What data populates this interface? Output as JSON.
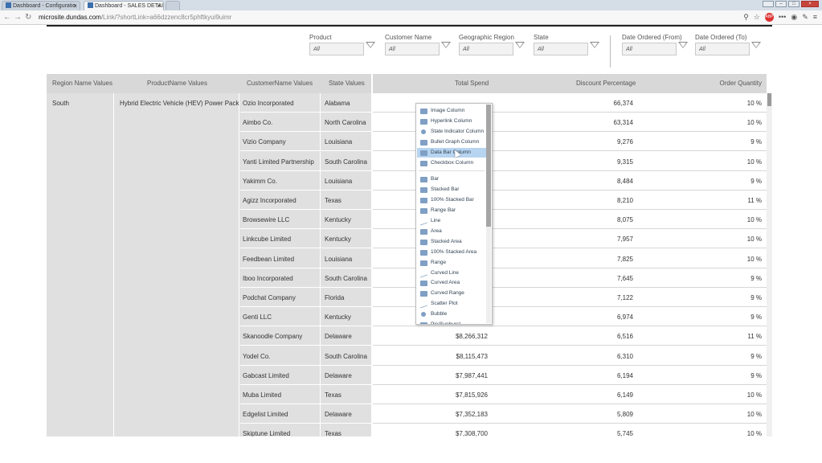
{
  "browser": {
    "tabs": [
      {
        "label": "Dashboard - Configuratio"
      },
      {
        "label": "Dashboard - SALES DETAI"
      }
    ],
    "url_domain": "microsite.dundas.com",
    "url_rest": "/Link/?shortLink=a66dzzenc8cr5phftkyui9uimr"
  },
  "filters": [
    {
      "label": "Product",
      "value": "All"
    },
    {
      "label": "Customer Name",
      "value": "All"
    },
    {
      "label": "Geographic Region",
      "value": "All"
    },
    {
      "label": "State",
      "value": "All"
    },
    {
      "label": "Date Ordered (From)",
      "value": "All"
    },
    {
      "label": "Date Ordered (To)",
      "value": "All"
    }
  ],
  "table": {
    "headers": {
      "region": "Region Name Values",
      "product": "ProductName Values",
      "customer": "CustomerName Values",
      "state": "State Values",
      "spend": "Total Spend",
      "discount": "Discount Percentage",
      "qty": "Order Quantity"
    },
    "region": "South",
    "product": "Hybrid Electric Vehicle (HEV) Power Pack",
    "rows": [
      {
        "customer": "Ozio Incorporated",
        "state": "Alabama",
        "spend": "",
        "discount": "66,374",
        "qty": "10 %"
      },
      {
        "customer": "Aimbo Co.",
        "state": "North Carolina",
        "spend": "",
        "discount": "63,314",
        "qty": "10 %"
      },
      {
        "customer": "Vizio Company",
        "state": "Louisiana",
        "spend": "",
        "discount": "9,276",
        "qty": "9 %"
      },
      {
        "customer": "Yanti Limited Partnership",
        "state": "South Carolina",
        "spend": "",
        "discount": "9,315",
        "qty": "10 %"
      },
      {
        "customer": "Yakimm Co.",
        "state": "Louisiana",
        "spend": "",
        "discount": "8,484",
        "qty": "9 %"
      },
      {
        "customer": "Agizz Incorporated",
        "state": "Texas",
        "spend": "",
        "discount": "8,210",
        "qty": "11 %"
      },
      {
        "customer": "Browsewire LLC",
        "state": "Kentucky",
        "spend": "",
        "discount": "8,075",
        "qty": "10 %"
      },
      {
        "customer": "Linkcube Limited",
        "state": "Kentucky",
        "spend": "",
        "discount": "7,957",
        "qty": "10 %"
      },
      {
        "customer": "Feedbean Limited",
        "state": "Louisiana",
        "spend": "",
        "discount": "7,825",
        "qty": "10 %"
      },
      {
        "customer": "Iboo Incorporated",
        "state": "South Carolina",
        "spend": "",
        "discount": "7,645",
        "qty": "9 %"
      },
      {
        "customer": "Podchat Company",
        "state": "Florida",
        "spend": "",
        "discount": "7,122",
        "qty": "9 %"
      },
      {
        "customer": "Genti LLC",
        "state": "Kentucky",
        "spend": "",
        "discount": "6,974",
        "qty": "9 %"
      },
      {
        "customer": "Skanoodle Company",
        "state": "Delaware",
        "spend": "$8,266,312",
        "discount": "6,516",
        "qty": "11 %"
      },
      {
        "customer": "Yodel Co.",
        "state": "South Carolina",
        "spend": "$8,115,473",
        "discount": "6,310",
        "qty": "9 %"
      },
      {
        "customer": "Gabcast Limited",
        "state": "Delaware",
        "spend": "$7,987,441",
        "discount": "6,194",
        "qty": "9 %"
      },
      {
        "customer": "Muba Limited",
        "state": "Texas",
        "spend": "$7,815,926",
        "discount": "6,149",
        "qty": "10 %"
      },
      {
        "customer": "Edgelist Limited",
        "state": "Delaware",
        "spend": "$7,352,183",
        "discount": "5,809",
        "qty": "10 %"
      },
      {
        "customer": "Skiptune Limited",
        "state": "Texas",
        "spend": "$7,308,700",
        "discount": "5,745",
        "qty": "10 %"
      }
    ]
  },
  "menu": {
    "group1": [
      {
        "label": "Image Column",
        "icon": "image-column-icon"
      },
      {
        "label": "Hyperlink Column",
        "icon": "hyperlink-column-icon"
      },
      {
        "label": "State Indicator Column",
        "icon": "state-indicator-icon"
      },
      {
        "label": "Bullet Graph Column",
        "icon": "bullet-graph-icon"
      },
      {
        "label": "Data Bar Column",
        "icon": "data-bar-icon",
        "selected": true
      },
      {
        "label": "Checkbox Column",
        "icon": "checkbox-column-icon"
      }
    ],
    "group2": [
      {
        "label": "Bar",
        "icon": "bar-chart-icon"
      },
      {
        "label": "Stacked Bar",
        "icon": "stacked-bar-icon"
      },
      {
        "label": "100% Stacked Bar",
        "icon": "stacked-bar-100-icon"
      },
      {
        "label": "Range Bar",
        "icon": "range-bar-icon"
      },
      {
        "label": "Line",
        "icon": "line-chart-icon"
      },
      {
        "label": "Area",
        "icon": "area-chart-icon"
      },
      {
        "label": "Stacked Area",
        "icon": "stacked-area-icon"
      },
      {
        "label": "100% Stacked Area",
        "icon": "stacked-area-100-icon"
      },
      {
        "label": "Range",
        "icon": "range-chart-icon"
      },
      {
        "label": "Curved Line",
        "icon": "curved-line-icon"
      },
      {
        "label": "Curved Area",
        "icon": "curved-area-icon"
      },
      {
        "label": "Curved Range",
        "icon": "curved-range-icon"
      },
      {
        "label": "Scatter Plot",
        "icon": "scatter-plot-icon"
      },
      {
        "label": "Bubble",
        "icon": "bubble-chart-icon"
      },
      {
        "label": "Pie/Sunburst",
        "icon": "pie-sunburst-icon"
      }
    ]
  }
}
